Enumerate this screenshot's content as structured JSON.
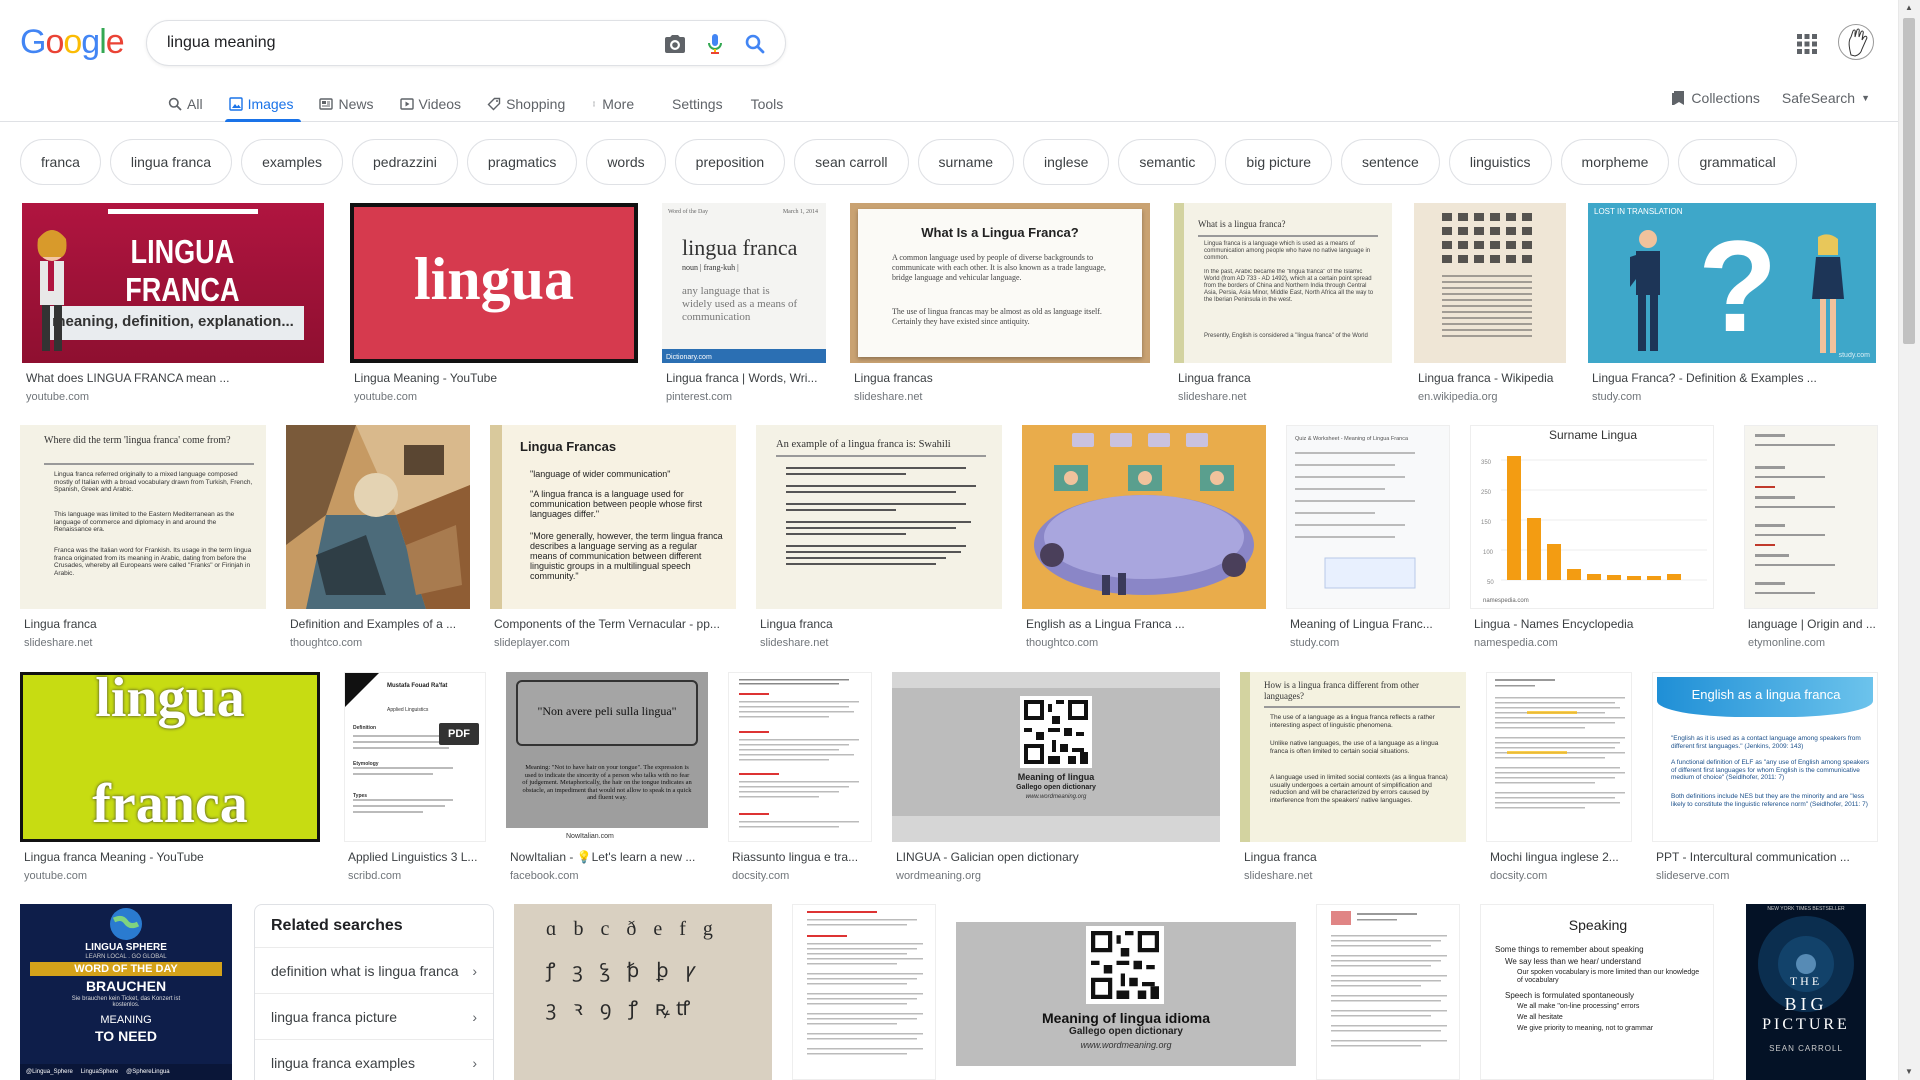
{
  "logo": {
    "letters": [
      "G",
      "o",
      "o",
      "g",
      "l",
      "e"
    ]
  },
  "search": {
    "query": "lingua meaning"
  },
  "tabs": [
    {
      "label": "All",
      "icon": "search-icon"
    },
    {
      "label": "Images",
      "icon": "image-icon"
    },
    {
      "label": "News",
      "icon": "news-icon"
    },
    {
      "label": "Videos",
      "icon": "video-icon"
    },
    {
      "label": "Shopping",
      "icon": "tag-icon"
    },
    {
      "label": "More",
      "icon": "more-vert-icon"
    }
  ],
  "active_tab": "Images",
  "tools": {
    "settings": "Settings",
    "tools": "Tools"
  },
  "right": {
    "collections": "Collections",
    "safesearch": "SafeSearch"
  },
  "chips": [
    "franca",
    "lingua franca",
    "examples",
    "pedrazzini",
    "pragmatics",
    "words",
    "preposition",
    "sean carroll",
    "surname",
    "inglese",
    "semantic",
    "big picture",
    "sentence",
    "linguistics",
    "morpheme",
    "grammatical"
  ],
  "row1": [
    {
      "title": "What does LINGUA FRANCA mean ...",
      "domain": "youtube.com",
      "thumb_text": {
        "a": "LINGUA FRANCA",
        "b": "meaning, definition, explanation..."
      }
    },
    {
      "title": "Lingua Meaning - YouTube",
      "domain": "youtube.com",
      "thumb_text": {
        "a": "lingua"
      }
    },
    {
      "title": "Lingua franca | Words, Wri...",
      "domain": "pinterest.com",
      "thumb_text": {
        "a": "Word of the Day",
        "b": "March 1, 2014",
        "c": "lingua franca",
        "d": "noun | frang-kuh |",
        "e": "any language that is widely used as a means of communication",
        "f": "Dictionary.com"
      }
    },
    {
      "title": "Lingua francas",
      "domain": "slideshare.net",
      "thumb_text": {
        "a": "What Is a Lingua Franca?",
        "b": "A common language used by people of diverse backgrounds to communicate with each other. It is also known as a trade language, bridge language and vehicular language.",
        "c": "The use of lingua francas may be almost as old as language itself. Certainly they have existed since antiquity."
      }
    },
    {
      "title": "Lingua franca",
      "domain": "slideshare.net",
      "thumb_text": {
        "a": "What is a lingua franca?",
        "b": "Lingua franca is a language which is used as a means of communication among people who have no native language in common.",
        "c": "In the past, Arabic became the \"lingua franca\" of the Islamic World (from AD 733 - AD 1492), which at a certain point spread from the borders of China and Northern India through Central Asia, Persia, Asia Minor, Middle East, North Africa all the way to the Iberian Peninsula in the west.",
        "d": "Presently, English is considered a \"lingua franca\" of the World"
      }
    },
    {
      "title": "Lingua franca - Wikipedia",
      "domain": "en.wikipedia.org",
      "thumb_text": {}
    },
    {
      "title": "Lingua Franca? - Definition & Examples ...",
      "domain": "study.com",
      "thumb_text": {
        "a": "LOST IN TRANSLATION",
        "b": "?",
        "c": "study.com"
      }
    }
  ],
  "row2": [
    {
      "title": "Lingua franca",
      "domain": "slideshare.net",
      "thumb_text": {
        "a": "Where did the term 'lingua franca' come from?",
        "b": "Lingua franca referred originally to a mixed language composed mostly of Italian with a broad vocabulary drawn from Turkish, French, Spanish, Greek and Arabic.",
        "c": "This language was limited to the Eastern Mediterranean as the language of commerce and diplomacy in and around the Renaissance era.",
        "d": "Franca was the Italian word for Frankish. Its usage in the term lingua franca originated from its meaning in Arabic, dating from before the Crusades, whereby all Europeans were called \"Franks\" or Firinjah in Arabic."
      }
    },
    {
      "title": "Definition and Examples of a ...",
      "domain": "thoughtco.com",
      "thumb_text": {}
    },
    {
      "title": "Components of the Term Vernacular - pp...",
      "domain": "slideplayer.com",
      "thumb_text": {
        "a": "Lingua Francas",
        "b": "\"language of wider communication\"",
        "c": "\"A lingua franca is a language used for communication between people whose first languages differ.\"",
        "d": "\"More generally, however, the term lingua franca describes a language serving as a regular means of communication between different linguistic groups in a multilingual speech community.\""
      }
    },
    {
      "title": "Lingua franca",
      "domain": "slideshare.net",
      "thumb_text": {
        "a": "An example of a lingua franca is: Swahili"
      }
    },
    {
      "title": "English as a Lingua Franca ...",
      "domain": "thoughtco.com",
      "thumb_text": {}
    },
    {
      "title": "Meaning of Lingua Franc...",
      "domain": "study.com",
      "thumb_text": {
        "a": "Quiz & Worksheet - Meaning of Lingua Franca"
      }
    },
    {
      "title": "Lingua - Names Encyclopedia",
      "domain": "namespedia.com",
      "thumb_text": {
        "a": "Surname Lingua",
        "b": "namespedia.com"
      }
    },
    {
      "title": "language | Origin and ...",
      "domain": "etymonline.com",
      "thumb_text": {}
    }
  ],
  "row3": [
    {
      "title": "Lingua franca Meaning - YouTube",
      "domain": "youtube.com",
      "thumb_text": {
        "a": "lingua",
        "b": "franca"
      }
    },
    {
      "title": "Applied Linguistics 3 L...",
      "domain": "scribd.com",
      "thumb_text": {
        "a": "PDF",
        "b": "Mustafa Fouad Ra'fat",
        "c": "Applied Linguistics",
        "d": "Definition",
        "e": "Etymology",
        "f": "Types"
      }
    },
    {
      "title": "NowItalian - 💡Let's learn a new ...",
      "domain": "facebook.com",
      "thumb_text": {
        "a": "\"Non avere peli sulla lingua\"",
        "b": "Meaning: \"Not to have hair on your tongue\". The expression is used to indicate the sincerity of a person who talks with no fear of judgement. Metaphorically, the hair on the tongue indicates an obstacle, an impediment that would not allow to speak in a quick and fluent way.",
        "c": "NowItalian.com"
      }
    },
    {
      "title": "Riassunto lingua e tra...",
      "domain": "docsity.com",
      "thumb_text": {}
    },
    {
      "title": "LINGUA - Galician open dictionary",
      "domain": "wordmeaning.org",
      "thumb_text": {
        "a": "Meaning of lingua",
        "b": "Gallego open dictionary",
        "c": "www.wordmeaning.org"
      }
    },
    {
      "title": "Lingua franca",
      "domain": "slideshare.net",
      "thumb_text": {
        "a": "How is a lingua franca different from other languages?",
        "b": "The use of a language as a lingua franca reflects a rather interesting aspect of linguistic phenomena.",
        "c": "Unlike native languages, the use of a language as a lingua franca is often limited to certain social situations.",
        "d": "A language used in limited social contexts (as a lingua franca) usually undergoes a certain amount of simplification and reduction and will be characterized by errors caused by interference from the speakers' native languages."
      }
    },
    {
      "title": "Mochi lingua inglese 2...",
      "domain": "docsity.com",
      "thumb_text": {}
    },
    {
      "title": "PPT - Intercultural communication ...",
      "domain": "slideserve.com",
      "thumb_text": {
        "a": "English as a lingua franca",
        "b": "\"English as it is used as a contact language among speakers from different first languages.\" (Jenkins, 2009: 143)",
        "c": "A functional definition of ELF as \"any use of English among speakers of different first languages for whom English is the communicative medium of choice\" (Seidlhofer, 2011: 7)",
        "d": "Both definitions include NES but they are the minority and are \"less likely to constitute the linguistic reference norm\" (Seidlhofer, 2011: 7)"
      }
    }
  ],
  "row4": [
    {
      "thumb_text": {
        "a": "LINGUA SPHERE",
        "b": "LEARN LOCAL . GO GLOBAL",
        "c": "WORD OF THE DAY",
        "d": "BRAUCHEN",
        "e": "Sie brauchen kein Ticket, das Konzert ist kostenlos.",
        "f": "MEANING",
        "g": "TO NEED",
        "h": "@Lingua_Sphere",
        "i": "LinguaSphere",
        "j": "@SphereLingua"
      }
    },
    {
      "thumb_text": {
        "a": "ɑ b c ð e f g",
        "b": "ꝭ ꝫ ꝣ ꝥ ꝧ ꝩ",
        "c": "ꝫ ꝛ ꝯ ꝭ ꝶꝷ"
      }
    },
    {
      "thumb_text": {}
    },
    {
      "thumb_text": {
        "a": "Meaning of lingua idioma",
        "b": "Gallego open dictionary",
        "c": "www.wordmeaning.org"
      }
    },
    {
      "thumb_text": {}
    },
    {
      "thumb_text": {
        "a": "Speaking",
        "b": "Some things to remember about speaking",
        "c": "We say less than we hear/ understand",
        "d": "Our spoken vocabulary is more limited than our knowledge of vocabulary",
        "e": "Speech is formulated spontaneously",
        "f": "We all make \"on-line processing\" errors",
        "g": "We all hesitate",
        "h": "We give priority to meaning, not to grammar"
      }
    },
    {
      "thumb_text": {
        "a": "NEW YORK TIMES BESTSELLER",
        "b": "THE",
        "c": "BIG",
        "d": "PICTURE",
        "e": "SEAN CARROLL"
      }
    }
  ],
  "related": {
    "heading": "Related searches",
    "items": [
      "definition what is lingua franca",
      "lingua franca picture",
      "lingua franca examples"
    ]
  },
  "colors": {
    "blue": "#4285f4",
    "red": "#ea4335",
    "yellow": "#fbbc05",
    "green": "#34a853",
    "link": "#1a73e8"
  }
}
